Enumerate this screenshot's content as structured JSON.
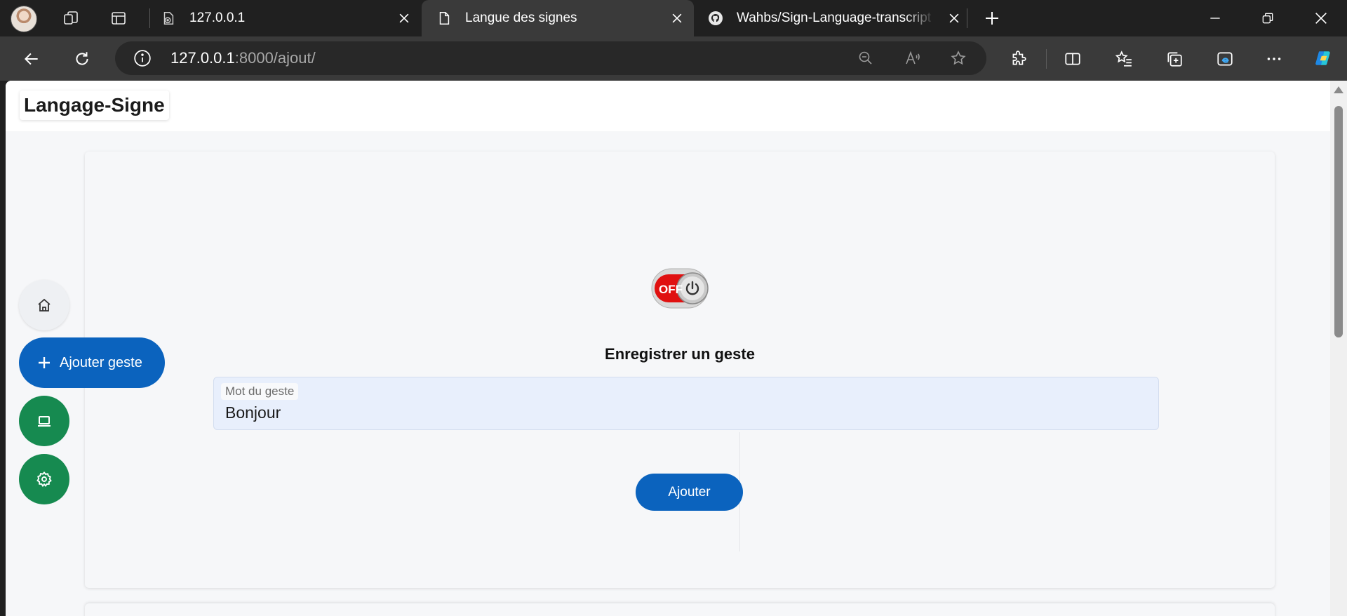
{
  "browser": {
    "tabs": [
      {
        "title": "127.0.0.1",
        "icon": "file-error-icon"
      },
      {
        "title": "Langue des signes",
        "icon": "page-icon"
      },
      {
        "title": "Wahbs/Sign-Language-transcript",
        "icon": "github-icon"
      }
    ],
    "url_host": "127.0.0.1",
    "url_rest": ":8000/ajout/"
  },
  "page": {
    "brand": "Langage-Signe",
    "form_title": "Enregistrer un geste",
    "field_label": "Mot du geste",
    "field_value": "Bonjour",
    "submit_label": "Ajouter",
    "toggle_text": "OFF"
  },
  "sidenav": {
    "add_label": "Ajouter geste"
  },
  "colors": {
    "primary": "#0b63be",
    "green": "#168a50",
    "toggle_red": "#e01010"
  }
}
